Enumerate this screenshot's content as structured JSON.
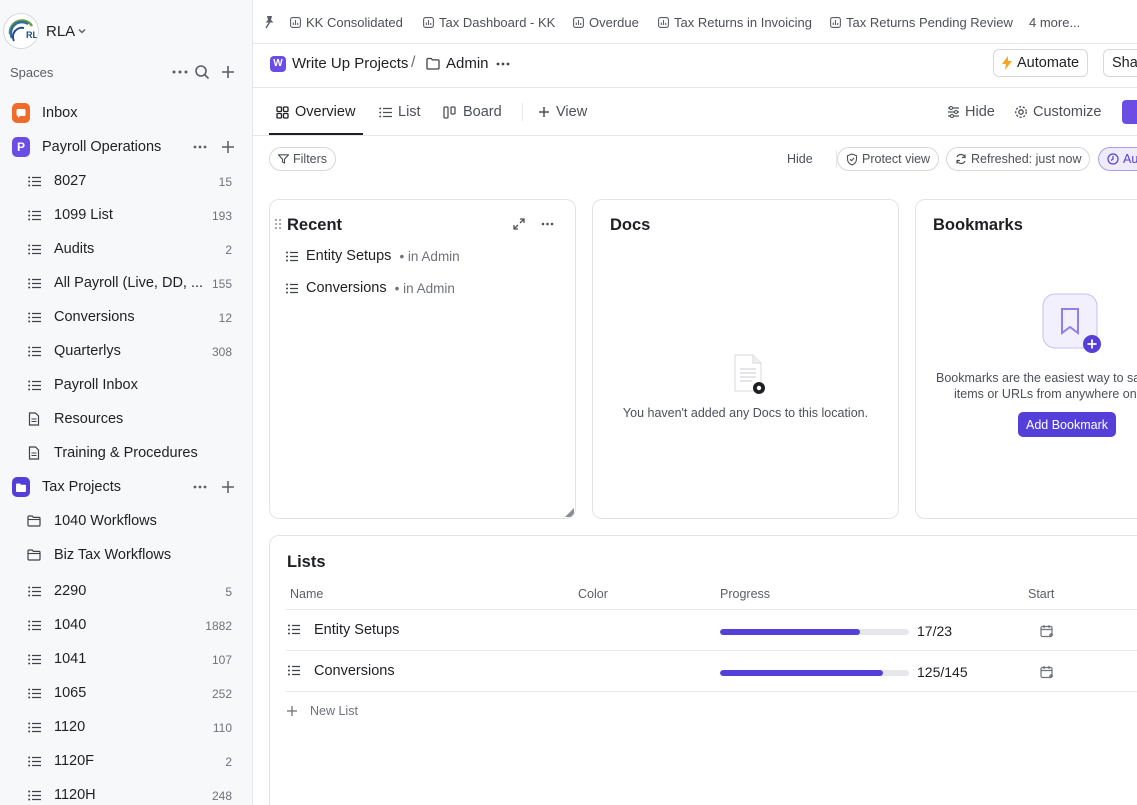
{
  "workspace": {
    "name": "RLA"
  },
  "sidebar": {
    "spaces_label": "Spaces",
    "inbox": {
      "label": "Inbox"
    },
    "payroll": {
      "label": "Payroll Operations",
      "badge": "P",
      "items": [
        {
          "label": "8027",
          "count": "15",
          "icon": "list-icon"
        },
        {
          "label": "1099 List",
          "count": "193",
          "icon": "list-icon"
        },
        {
          "label": "Audits",
          "count": "2",
          "icon": "list-icon"
        },
        {
          "label": "All Payroll (Live, DD, ...",
          "count": "155",
          "icon": "list-icon"
        },
        {
          "label": "Conversions",
          "count": "12",
          "icon": "list-icon"
        },
        {
          "label": "Quarterlys",
          "count": "308",
          "icon": "list-icon"
        },
        {
          "label": "Payroll Inbox",
          "count": "",
          "icon": "list-icon"
        },
        {
          "label": "Resources",
          "count": "",
          "icon": "doc-icon"
        },
        {
          "label": "Training & Procedures",
          "count": "",
          "icon": "doc-icon"
        }
      ]
    },
    "tax": {
      "label": "Tax Projects",
      "items": [
        {
          "label": "1040 Workflows",
          "count": "",
          "icon": "folder-icon"
        },
        {
          "label": "Biz Tax Workflows",
          "count": "",
          "icon": "folder-icon"
        },
        {
          "label": "2290",
          "count": "5",
          "icon": "list-icon"
        },
        {
          "label": "1040",
          "count": "1882",
          "icon": "list-icon"
        },
        {
          "label": "1041",
          "count": "107",
          "icon": "list-icon"
        },
        {
          "label": "1065",
          "count": "252",
          "icon": "list-icon"
        },
        {
          "label": "1120",
          "count": "110",
          "icon": "list-icon"
        },
        {
          "label": "1120F",
          "count": "2",
          "icon": "list-icon"
        },
        {
          "label": "1120H",
          "count": "248",
          "icon": "list-icon"
        }
      ]
    }
  },
  "bookmarks_bar": [
    "KK Consolidated",
    "Tax Dashboard - KK",
    "Overdue",
    "Tax Returns in Invoicing",
    "Tax Returns Pending Review",
    "4 more..."
  ],
  "breadcrumb": {
    "badge": "W",
    "space": "Write Up Projects",
    "sep": "/",
    "folder": "Admin"
  },
  "header": {
    "automate": "Automate",
    "share": "Sha"
  },
  "tabs": {
    "overview": "Overview",
    "list": "List",
    "board": "Board",
    "add_view": "View",
    "hide": "Hide",
    "customize": "Customize"
  },
  "filters": {
    "filters": "Filters",
    "hide": "Hide",
    "protect": "Protect view",
    "refreshed": "Refreshed: just now",
    "auto": "Au"
  },
  "recent": {
    "title": "Recent",
    "items": [
      {
        "name": "Entity Setups",
        "loc": "• in Admin"
      },
      {
        "name": "Conversions",
        "loc": "• in Admin"
      }
    ]
  },
  "docs": {
    "title": "Docs",
    "empty": "You haven't added any Docs to this location."
  },
  "bookmarks": {
    "title": "Bookmarks",
    "desc_line1": "Bookmarks are the easiest way to sa",
    "desc_line2": "items or URLs from anywhere on",
    "button": "Add Bookmark"
  },
  "lists": {
    "title": "Lists",
    "columns": {
      "name": "Name",
      "color": "Color",
      "progress": "Progress",
      "start": "Start"
    },
    "rows": [
      {
        "name": "Entity Setups",
        "progress_text": "17/23",
        "progress": 0.739
      },
      {
        "name": "Conversions",
        "progress_text": "125/145",
        "progress": 0.862
      }
    ],
    "new_list": "New List"
  },
  "colors": {
    "accent": "#5440d8",
    "inbox": "#f26b2a",
    "payroll": "#6b4de6",
    "tax": "#5440d8"
  }
}
